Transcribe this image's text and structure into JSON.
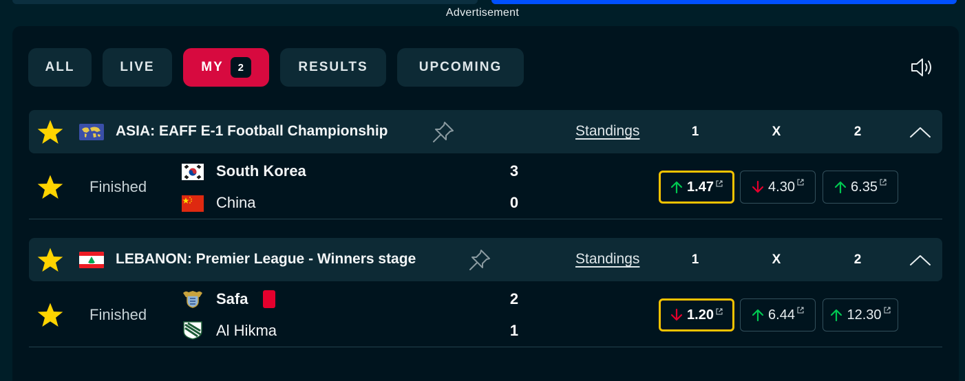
{
  "advertisement": "Advertisement",
  "tabs": [
    {
      "label": "ALL",
      "active": false
    },
    {
      "label": "LIVE",
      "active": false
    },
    {
      "label": "MY",
      "active": true,
      "badge": "2"
    },
    {
      "label": "RESULTS",
      "active": false
    },
    {
      "label": "UPCOMING",
      "active": false
    }
  ],
  "leagues": [
    {
      "name": "ASIA: EAFF E-1 Football Championship",
      "standings_label": "Standings",
      "odds_headers": [
        "1",
        "X",
        "2"
      ],
      "match": {
        "status": "Finished",
        "home": {
          "name": "South Korea",
          "score": "3"
        },
        "away": {
          "name": "China",
          "score": "0"
        },
        "odds": [
          {
            "value": "1.47",
            "trend": "up",
            "best": true
          },
          {
            "value": "4.30",
            "trend": "down",
            "best": false
          },
          {
            "value": "6.35",
            "trend": "up",
            "best": false
          }
        ]
      }
    },
    {
      "name": "LEBANON: Premier League - Winners stage",
      "standings_label": "Standings",
      "odds_headers": [
        "1",
        "X",
        "2"
      ],
      "match": {
        "status": "Finished",
        "home": {
          "name": "Safa",
          "score": "2",
          "red_cards": 1
        },
        "away": {
          "name": "Al Hikma",
          "score": "1"
        },
        "odds": [
          {
            "value": "1.20",
            "trend": "down",
            "best": true
          },
          {
            "value": "6.44",
            "trend": "up",
            "best": false
          },
          {
            "value": "12.30",
            "trend": "up",
            "best": false
          }
        ]
      }
    }
  ],
  "colors": {
    "background": "#001e28",
    "panel": "#00141e",
    "active_tab": "#d70a3f",
    "star": "#ffd400",
    "best_odd_border": "#f7c300",
    "trend_up": "#00c851",
    "trend_down": "#e5002d"
  },
  "icons": {
    "sound": "speaker-icon",
    "pin": "pin-icon",
    "favorite": "star-icon",
    "collapse": "chevron-up-icon",
    "external": "external-link-icon"
  }
}
